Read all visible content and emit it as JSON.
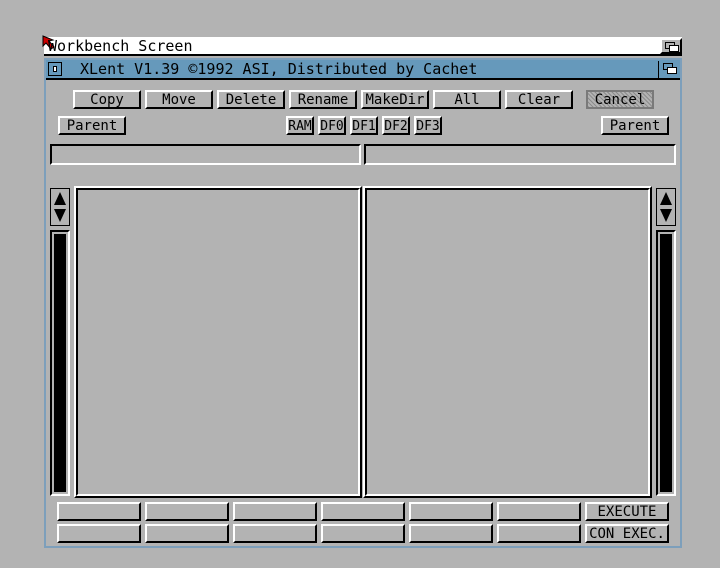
{
  "screen": {
    "title": "Workbench Screen"
  },
  "window": {
    "title": "XLent V1.39 ©1992 ASI, Distributed by Cachet"
  },
  "toolbar": {
    "buttons": [
      {
        "label": "Copy"
      },
      {
        "label": "Move"
      },
      {
        "label": "Delete"
      },
      {
        "label": "Rename"
      },
      {
        "label": "MakeDir"
      },
      {
        "label": "All"
      },
      {
        "label": "Clear"
      },
      {
        "label": "Cancel"
      }
    ]
  },
  "nav": {
    "left_parent": "Parent",
    "right_parent": "Parent",
    "devices": [
      "RAM",
      "DF0",
      "DF1",
      "DF2",
      "DF3"
    ]
  },
  "paths": {
    "left": "",
    "right": ""
  },
  "bottom": {
    "execute": "EXECUTE",
    "con_exec": "CON EXEC."
  },
  "colors": {
    "screen_bg": "#b3b3b3",
    "titlebar_active": "#6699bb",
    "titlebar_text": "#000000",
    "window_border": "#7d9fbb"
  }
}
